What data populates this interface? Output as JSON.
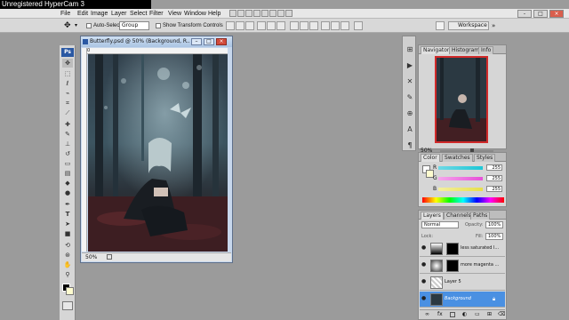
{
  "watermark": "Unregistered HyperCam 3",
  "menu": [
    "File",
    "Edit",
    "Image",
    "Layer",
    "Select",
    "Filter",
    "View",
    "Window",
    "Help"
  ],
  "window_buttons": [
    "-",
    "□",
    "×"
  ],
  "options": {
    "auto_select_label": "Auto-Select:",
    "auto_select_value": "Group",
    "show_transform_label": "Show Transform Controls",
    "workspace_label": "Workspace"
  },
  "tools": {
    "logo": "Ps",
    "icons": [
      "move-tool",
      "marquee-tool",
      "lasso-tool",
      "quick-select-tool",
      "crop-tool",
      "eyedropper-tool",
      "healing-tool",
      "brush-tool",
      "clone-stamp-tool",
      "history-brush-tool",
      "eraser-tool",
      "gradient-tool",
      "blur-tool",
      "dodge-tool",
      "pen-tool",
      "type-tool",
      "path-select-tool",
      "shape-tool",
      "3d-rotate-tool",
      "3d-orbit-tool",
      "hand-tool",
      "zoom-tool"
    ]
  },
  "document": {
    "title": "Butterfly.psd @ 50% (Background, R...",
    "zoom": "50%",
    "ruler_mark": "0"
  },
  "navigator": {
    "tabs": [
      "Navigator",
      "Histogram",
      "Info"
    ],
    "zoom": "50%"
  },
  "color_panel": {
    "tabs": [
      "Color",
      "Swatches",
      "Styles"
    ],
    "channels": [
      {
        "label": "R",
        "value": "255",
        "gradient": "#1cc7d6"
      },
      {
        "label": "G",
        "value": "255",
        "gradient": "#e84fd8"
      },
      {
        "label": "B",
        "value": "255",
        "gradient": "#e7e04a"
      }
    ]
  },
  "layers_panel": {
    "tabs": [
      "Layers",
      "Channels",
      "Paths"
    ],
    "blend_mode": "Normal",
    "opacity_label": "Opacity:",
    "opacity_value": "100%",
    "lock_label": "Lock:",
    "fill_label": "Fill:",
    "fill_value": "100%",
    "layers": [
      {
        "name": "less saturated l...",
        "type": "adjustment"
      },
      {
        "name": "more magenta ...",
        "type": "adjustment"
      },
      {
        "name": "Layer 5",
        "type": "pixel"
      },
      {
        "name": "Background",
        "type": "background",
        "selected": true
      }
    ]
  }
}
